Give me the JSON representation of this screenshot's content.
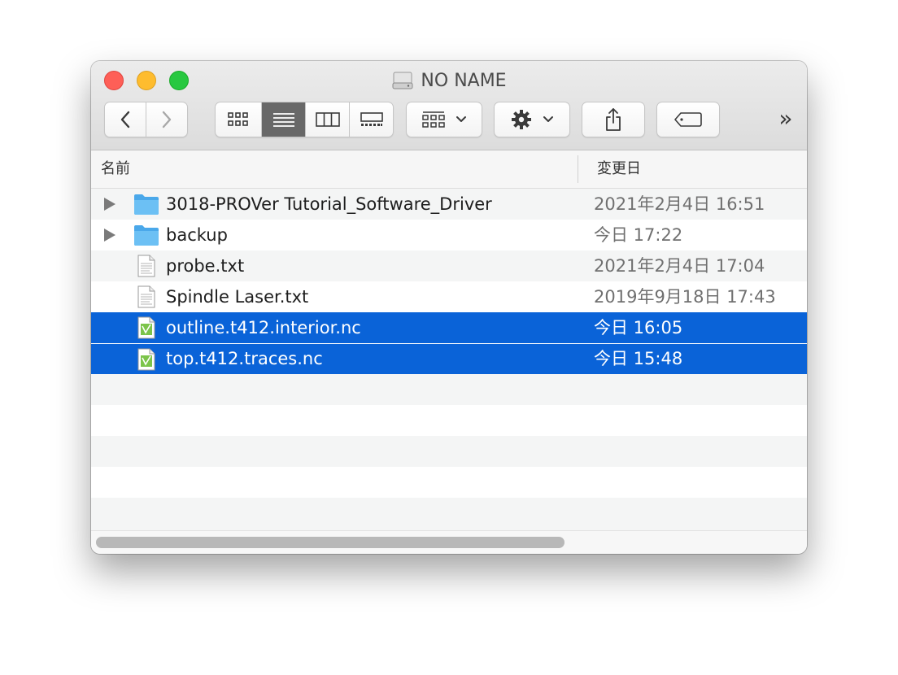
{
  "window": {
    "title": "NO NAME"
  },
  "toolbar": {
    "back_label": "back",
    "forward_label": "forward",
    "more_label": "»"
  },
  "columns": {
    "name": "名前",
    "date": "変更日"
  },
  "files": [
    {
      "name": "3018-PROVer Tutorial_Software_Driver",
      "date": "2021年2月4日 16:51",
      "type": "folder",
      "expandable": true,
      "selected": false
    },
    {
      "name": "backup",
      "date": "今日 17:22",
      "type": "folder",
      "expandable": true,
      "selected": false
    },
    {
      "name": "probe.txt",
      "date": "2021年2月4日 17:04",
      "type": "text",
      "expandable": false,
      "selected": false
    },
    {
      "name": "Spindle Laser.txt",
      "date": "2019年9月18日 17:43",
      "type": "text",
      "expandable": false,
      "selected": false
    },
    {
      "name": "outline.t412.interior.nc",
      "date": "今日 16:05",
      "type": "nc",
      "expandable": false,
      "selected": true
    },
    {
      "name": "top.t412.traces.nc",
      "date": "今日 15:48",
      "type": "nc",
      "expandable": false,
      "selected": true
    }
  ],
  "colors": {
    "selection": "#0a63d8",
    "folder": "#5ab4ee"
  }
}
